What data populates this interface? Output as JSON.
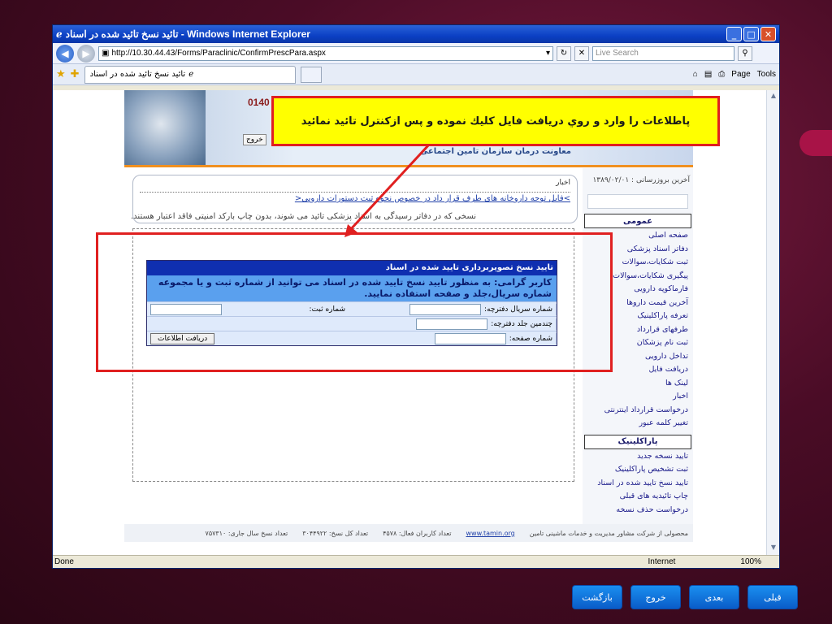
{
  "window": {
    "title": "تائید نسخ تائید شده در اسناد - Windows Internet Explorer",
    "url": "http://10.30.44.43/Forms/Paraclinic/ConfirmPrescPara.aspx",
    "search_placeholder": "Live Search",
    "tab_title": "تائید نسخ تائید شده در اسناد",
    "tools": {
      "page": "Page",
      "tools": "Tools"
    },
    "status": {
      "done": "Done",
      "zone": "Internet",
      "zoom": "100%"
    }
  },
  "banner": {
    "phone": "0140",
    "exit": "خروج",
    "org": "معاونت درمان سازمان تامین اجتماعی"
  },
  "news": {
    "title": "اخبار",
    "link": ">فایل توجه داروخانه های طرف قرار داد در خصوص نحوه ثبت دستورات دارویی<",
    "note": "نسخی که در دفاتر رسیدگی به اسناد پزشکی تائید می شوند، بدون چاپ بارکد امنیتی فاقد اعتبار هستند."
  },
  "form": {
    "header": "تایید نسخ تصویربرداری تایید شده در اسناد",
    "message": "کاربر گرامی: به منظور تایید نسخ تایید شده در اسناد می توانید از شماره ثبت و یا مجموعه شماره سریال،جلد و صفحه استفاده نمایید.",
    "serial_label": "شماره سریال دفترچه:",
    "reg_label": "شماره ثبت:",
    "volume_label": "چندمین جلد دفترچه:",
    "page_label": "شماره صفحه:",
    "fetch_button": "دریافت اطلاعات"
  },
  "sidebar": {
    "updated": "آخرین بروزرسانی : ۱۳۸۹/۰۲/۰۱",
    "group_general": "عمومی",
    "general_items": [
      "صفحه اصلی",
      "دفاتر اسناد پزشکی",
      "ثبت شکایات،سوالات",
      "پیگیری شکایات،سوالات",
      "فارماکوپه دارویی",
      "آخرین قیمت داروها",
      "تعرفه پاراکلینیک",
      "طرفهای قرارداد",
      "ثبت نام پزشکان",
      "تداخل دارویی",
      "دریافت فایل",
      "لینک ها",
      "اخبار",
      "درخواست قرارداد اینترنتی",
      "تغییر کلمه عبور"
    ],
    "group_paraclinic": "پاراکلینیک",
    "paraclinic_items": [
      "تایید نسخه جدید",
      "ثبت تشخیص پاراکلینیک",
      "تایید نسخ تایید شده در اسناد",
      "چاپ تائیدیه های قبلی",
      "درخواست حذف نسخه"
    ]
  },
  "footer": {
    "credit": "محصولی از شرکت مشاور مدیریت و خدمات ماشینی تامین",
    "site": "www.tamin.org",
    "active_users": "تعداد کاربران فعال: ۴۵۷۸",
    "total_presc": "تعداد کل نسخ: ۳۰۴۴۹۲۲",
    "year_presc": "تعداد نسخ سال جاری: ۷۵۷۳۱۰"
  },
  "annotation": {
    "callout": "پاطلاعات را وارد و روي دريافت فايل كليك نموده و پس ازكنترل تائيد نمائيد"
  },
  "slide_nav": {
    "prev": "قبلی",
    "next": "بعدی",
    "exit": "خروج",
    "back": "بازگشت"
  }
}
